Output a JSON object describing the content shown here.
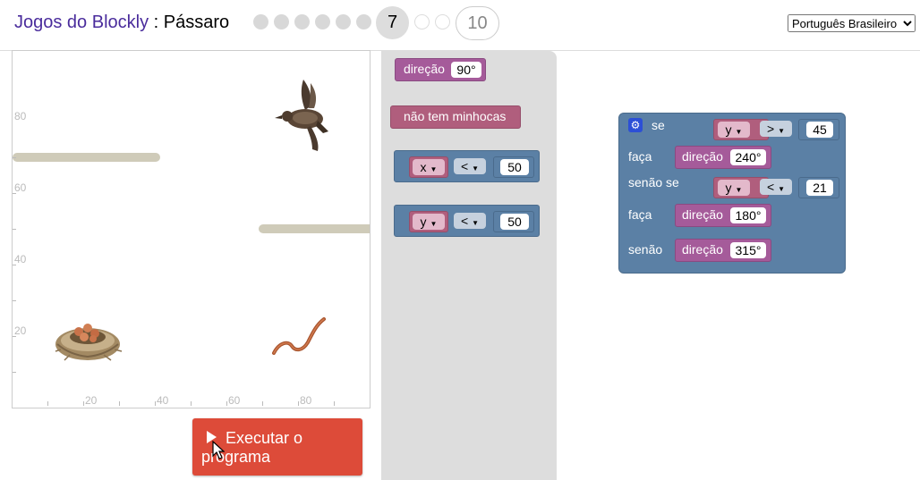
{
  "header": {
    "app_name": "Jogos do Blockly",
    "separator": " : ",
    "game_name": "Pássaro",
    "current_level": "7",
    "last_level": "10",
    "language": "Português Brasileiro"
  },
  "canvas": {
    "y_ticks": [
      "80",
      "60",
      "40",
      "20"
    ],
    "x_ticks": [
      "20",
      "40",
      "60",
      "80"
    ]
  },
  "run_button": {
    "label": "Executar o programa"
  },
  "toolbox": {
    "heading_label": "direção",
    "heading_value": "90°",
    "no_worm_label": "não tem minhocas",
    "compare_x": {
      "var": "x",
      "op": "<",
      "value": "50"
    },
    "compare_y": {
      "var": "y",
      "op": "<",
      "value": "50"
    }
  },
  "workspace": {
    "if_label": "se",
    "do_label": "faça",
    "elseif_label": "senão se",
    "else_label": "senão",
    "cond1": {
      "var": "y",
      "op": ">",
      "value": "45"
    },
    "cond2": {
      "var": "y",
      "op": "<",
      "value": "21"
    },
    "heading_label": "direção",
    "heading1": "240°",
    "heading2": "180°",
    "heading3": "315°"
  },
  "icons": {
    "bird": "bird-icon",
    "nest": "nest-icon",
    "worm": "worm-icon",
    "gear": "gear-icon",
    "play": "play-icon",
    "cursor": "mouse-cursor-icon"
  },
  "colors": {
    "title_accent": "#4a2c9c",
    "run_button": "#dd4b39",
    "block_heading": "#a55b9a",
    "block_logic": "#5b80a5",
    "block_sensor": "#b05e7d",
    "wall": "#cfcbb9"
  }
}
